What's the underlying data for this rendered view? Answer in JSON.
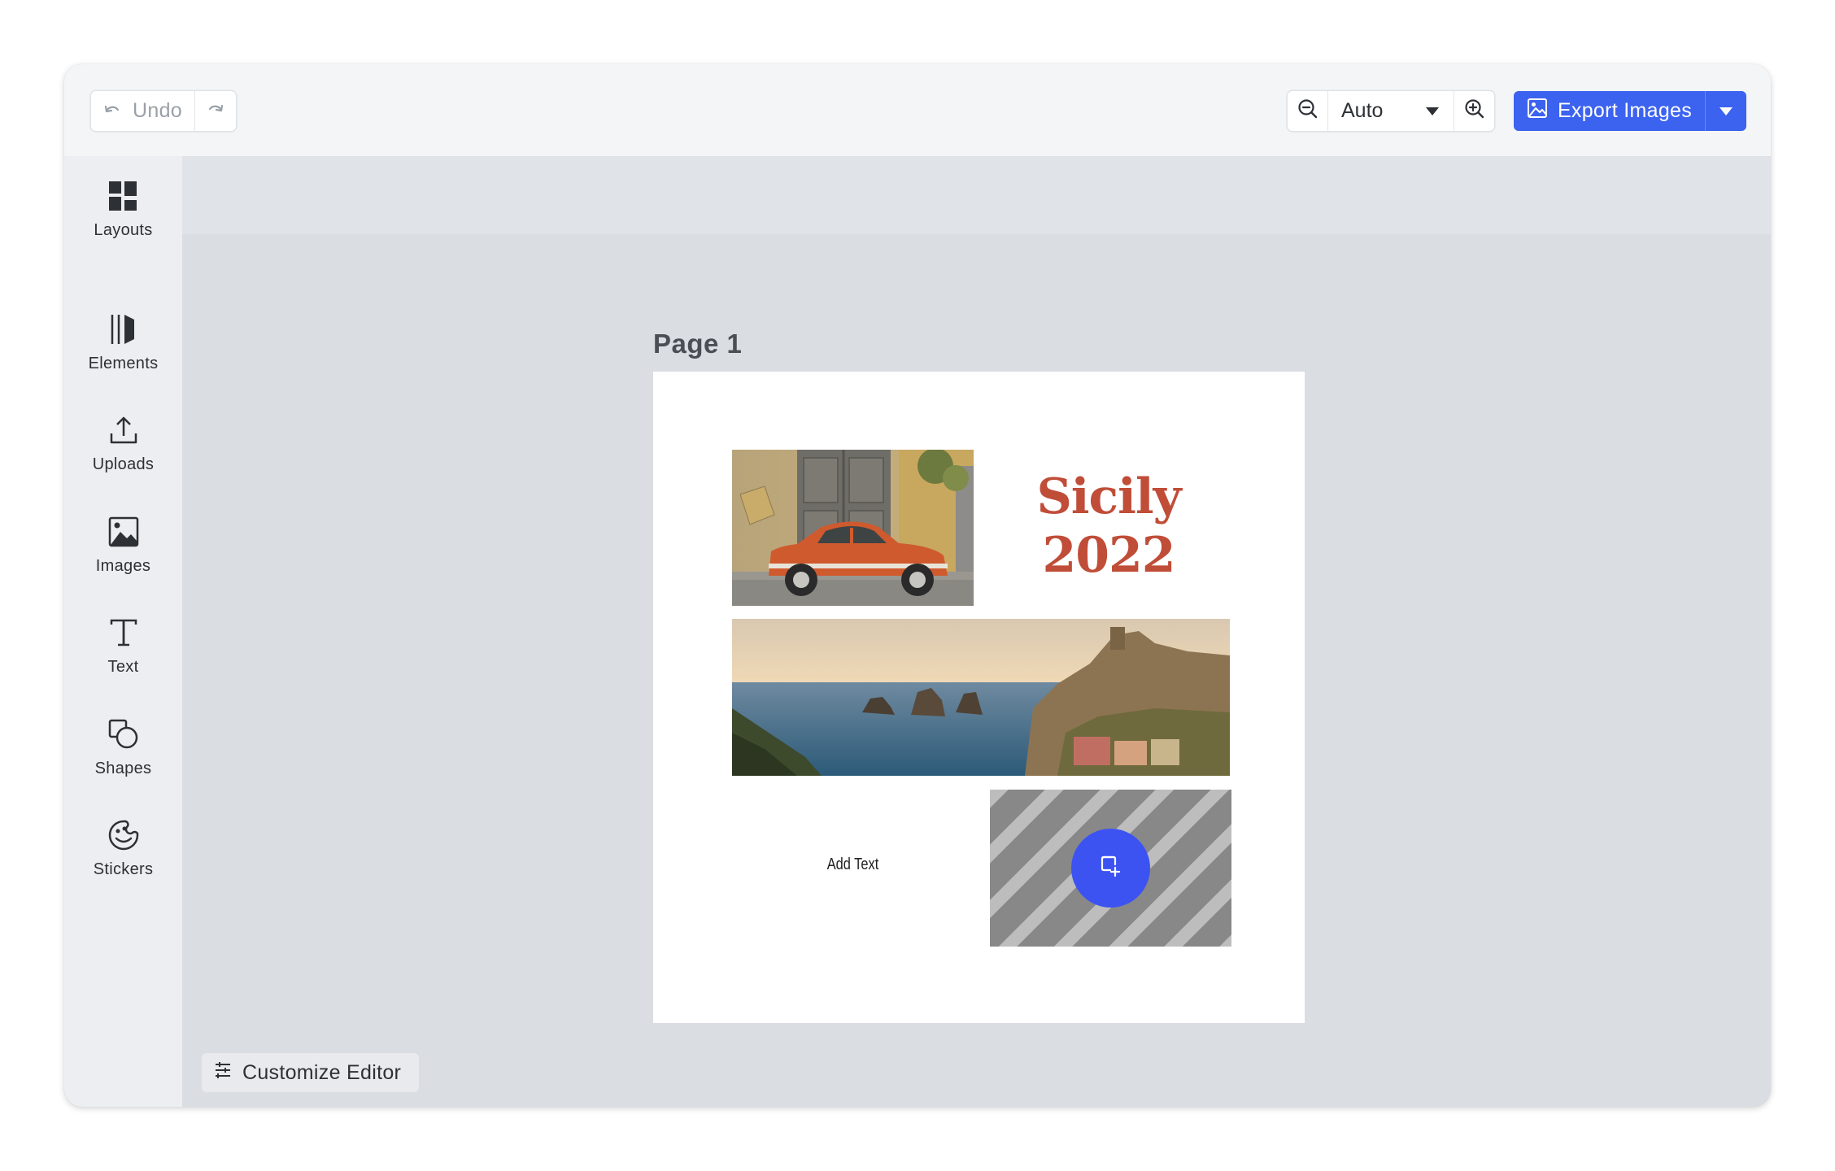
{
  "toolbar": {
    "undo_label": "Undo",
    "zoom_value": "Auto",
    "export_label": "Export Images"
  },
  "sidebar": {
    "items": [
      {
        "label": "Layouts",
        "icon": "layouts-icon"
      },
      {
        "label": "Elements",
        "icon": "elements-icon"
      },
      {
        "label": "Uploads",
        "icon": "upload-icon"
      },
      {
        "label": "Images",
        "icon": "image-icon"
      },
      {
        "label": "Text",
        "icon": "text-icon"
      },
      {
        "label": "Shapes",
        "icon": "shapes-icon"
      },
      {
        "label": "Stickers",
        "icon": "sticker-icon"
      }
    ]
  },
  "canvas": {
    "page_label": "Page 1",
    "title_line1": "Sicily",
    "title_line2": "2022",
    "add_text": "Add Text"
  },
  "footer": {
    "customize_label": "Customize Editor"
  },
  "colors": {
    "accent": "#3c62f0",
    "title_red": "#c04d38"
  }
}
